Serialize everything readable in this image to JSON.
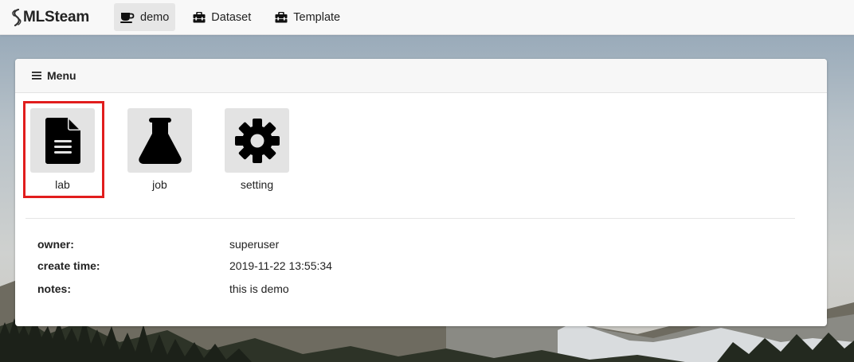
{
  "brand": {
    "name": "MLSteam"
  },
  "nav": {
    "items": [
      {
        "label": "demo",
        "icon": "coffee-cup-icon",
        "active": true
      },
      {
        "label": "Dataset",
        "icon": "toolbox-icon",
        "active": false
      },
      {
        "label": "Template",
        "icon": "toolbox-icon",
        "active": false
      }
    ]
  },
  "menu": {
    "title": "Menu",
    "tiles": [
      {
        "label": "lab",
        "icon": "file-icon",
        "highlighted": true
      },
      {
        "label": "job",
        "icon": "flask-icon",
        "highlighted": false
      },
      {
        "label": "setting",
        "icon": "gear-icon",
        "highlighted": false
      }
    ]
  },
  "info": {
    "owner_label": "owner:",
    "owner_value": "superuser",
    "create_time_label": "create time:",
    "create_time_value": "2019-11-22 13:55:34",
    "notes_label": "notes:",
    "notes_value": "this is demo"
  },
  "colors": {
    "highlight": "#e11d1d",
    "tile_bg": "#e3e3e3",
    "nav_active_bg": "#e6e6e6"
  }
}
